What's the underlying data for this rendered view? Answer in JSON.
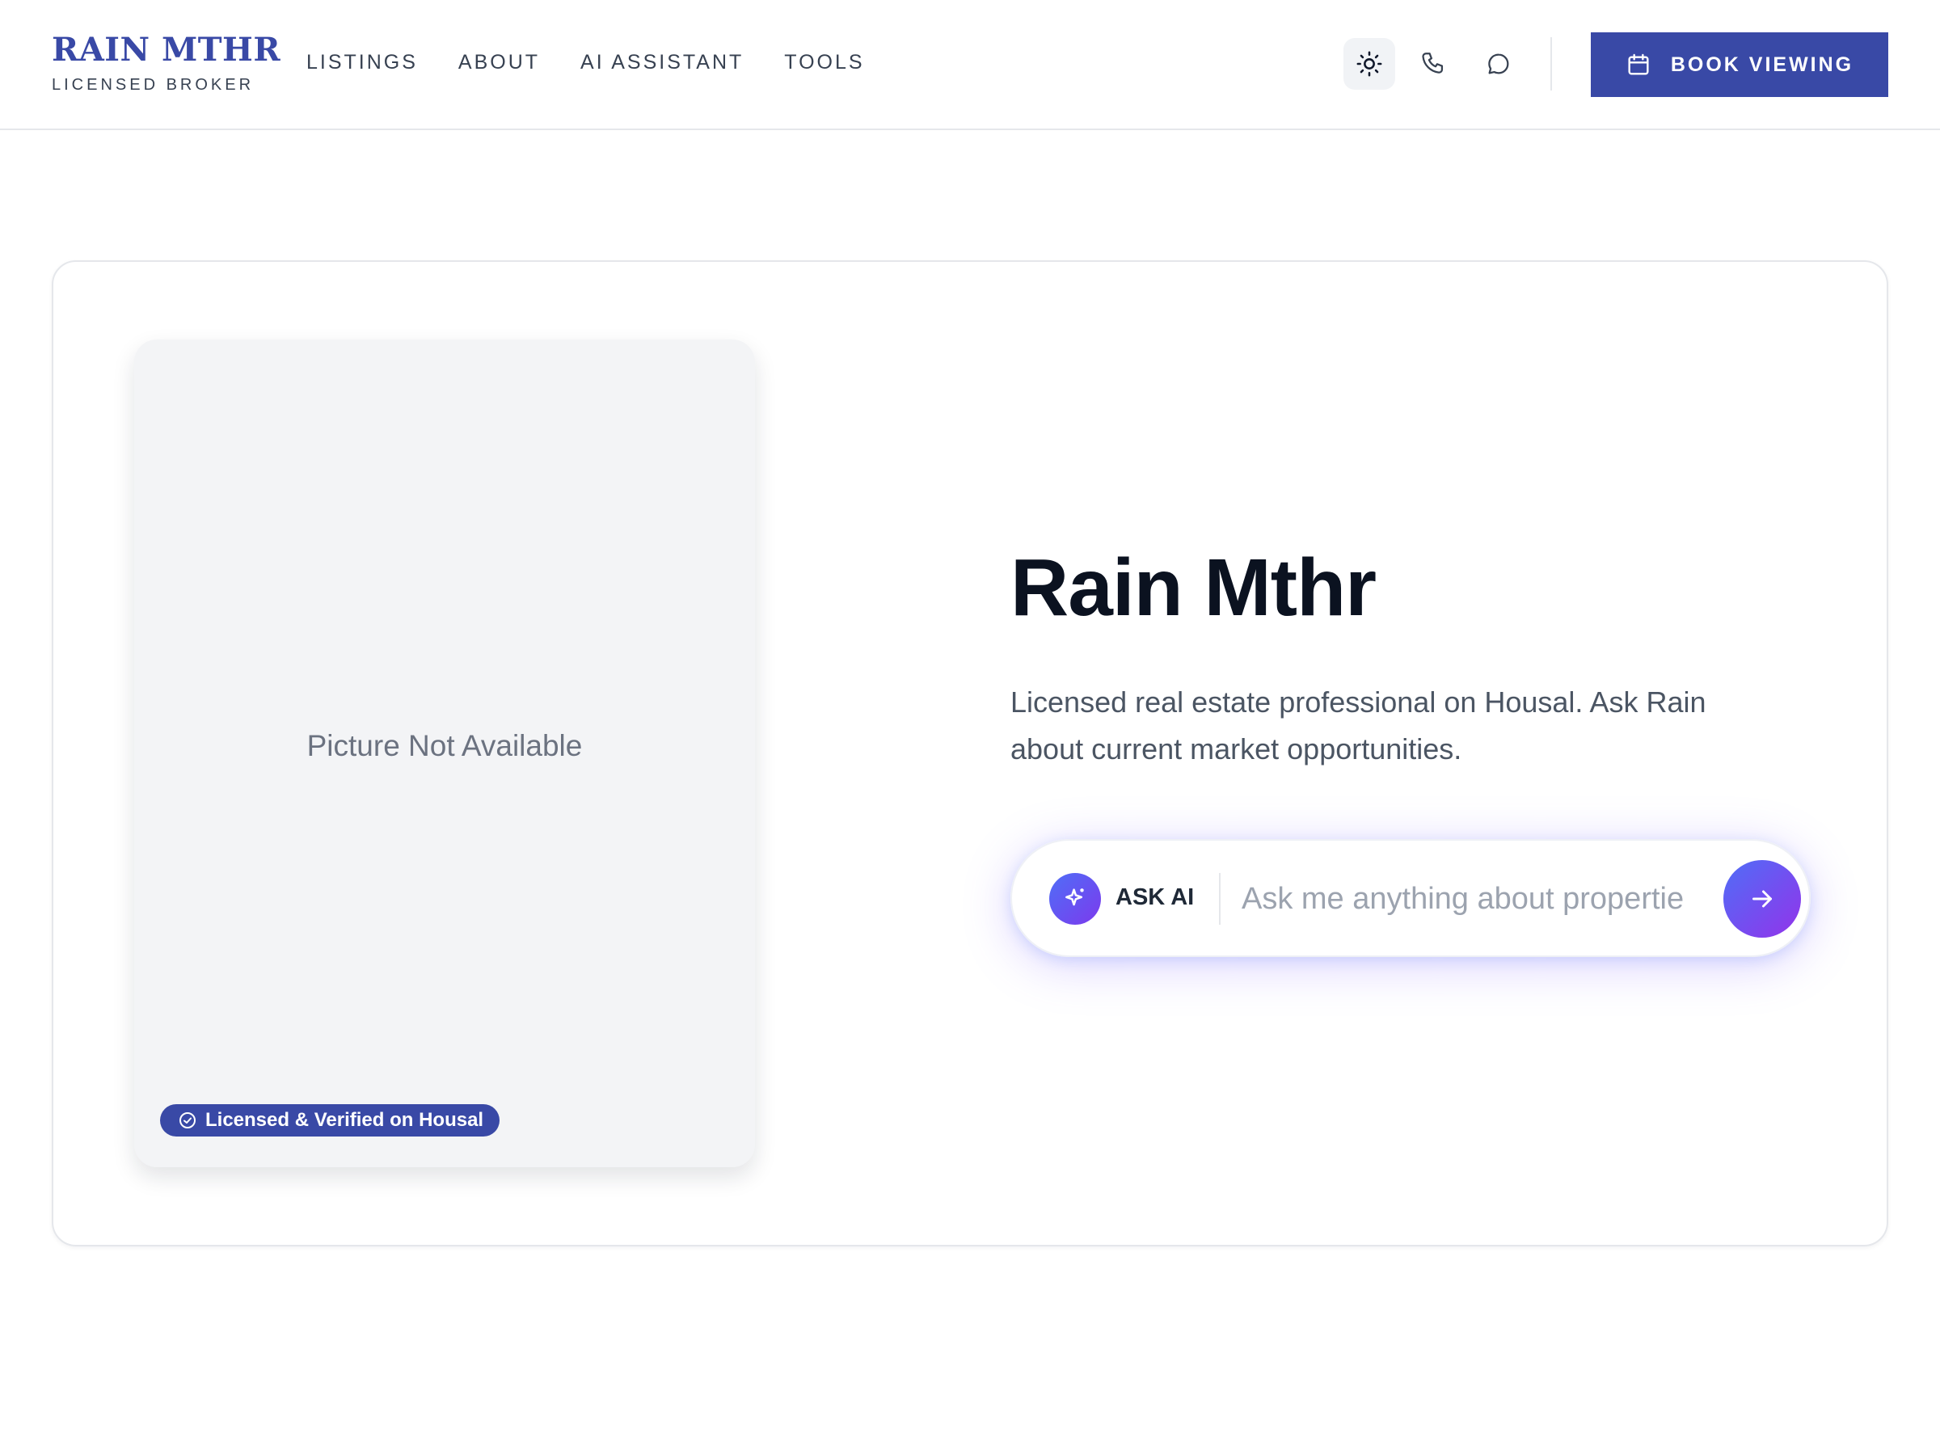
{
  "header": {
    "brand_name": "RAIN MTHR",
    "brand_tag": "LICENSED BROKER",
    "nav": [
      {
        "label": "LISTINGS"
      },
      {
        "label": "ABOUT"
      },
      {
        "label": "AI ASSISTANT"
      },
      {
        "label": "TOOLS"
      }
    ],
    "icons": [
      "sun-icon",
      "phone-icon",
      "chat-icon"
    ],
    "book_button_label": "BOOK VIEWING",
    "accent_color": "#3949a6"
  },
  "profile": {
    "photo_placeholder": "Picture Not Available",
    "badge_label": "Licensed & Verified on Housal",
    "name": "Rain Mthr",
    "bio": "Licensed real estate professional on Housal. Ask Rain about current market opportunities."
  },
  "ask_ai": {
    "label": "ASK AI",
    "placeholder": "Ask me anything about propertie",
    "value": "",
    "gradient_start": "#4f6ef7",
    "gradient_end": "#9333ea"
  }
}
